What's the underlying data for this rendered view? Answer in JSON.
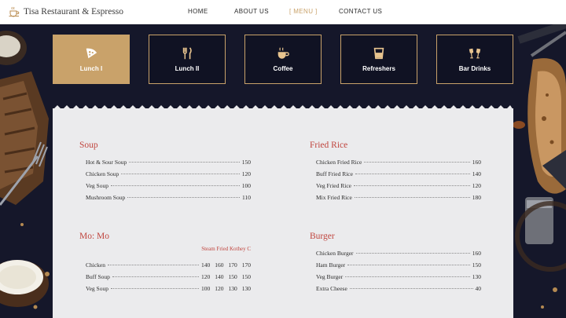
{
  "brand": {
    "name": "Tisa Restaurant & Espresso",
    "logo_icon": "coffee-cup-icon"
  },
  "nav": {
    "items": [
      {
        "label": "HOME"
      },
      {
        "label": "ABOUT US"
      },
      {
        "label": "[ MENU ]"
      },
      {
        "label": "CONTACT US"
      }
    ],
    "active_index": 2
  },
  "categories": [
    {
      "label": "Lunch I",
      "icon": "pizza-slice-icon",
      "active": true
    },
    {
      "label": "Lunch II",
      "icon": "fork-knife-icon",
      "active": false
    },
    {
      "label": "Coffee",
      "icon": "coffee-cup-icon",
      "active": false
    },
    {
      "label": "Refreshers",
      "icon": "glass-icon",
      "active": false
    },
    {
      "label": "Bar Drinks",
      "icon": "cheers-glasses-icon",
      "active": false
    }
  ],
  "colors": {
    "accent_gold": "#c9a26a",
    "section_title_red": "#c0453e",
    "background_navy": "#15172a",
    "panel_grey": "#ebebed"
  },
  "menu": {
    "soup": {
      "title": "Soup",
      "items": [
        {
          "name": "Hot & Sour Soup",
          "price": "150"
        },
        {
          "name": "Chicken Soup",
          "price": "120"
        },
        {
          "name": "Veg Soup",
          "price": "100"
        },
        {
          "name": "Mushroom Soup",
          "price": "110"
        }
      ]
    },
    "fried_rice": {
      "title": "Fried Rice",
      "items": [
        {
          "name": "Chicken Fried Rice",
          "price": "160"
        },
        {
          "name": "Buff Fried Rice",
          "price": "140"
        },
        {
          "name": "Veg Fried Rice",
          "price": "120"
        },
        {
          "name": "Mix Fried Rice",
          "price": "180"
        }
      ]
    },
    "momo": {
      "title": "Mo: Mo",
      "subheader": "Steam Fried Kothey C",
      "items": [
        {
          "name": "Chicken",
          "prices": [
            "140",
            "160",
            "170",
            "170"
          ]
        },
        {
          "name": "Buff Soup",
          "prices": [
            "120",
            "140",
            "150",
            "150"
          ]
        },
        {
          "name": "Veg Soup",
          "prices": [
            "100",
            "120",
            "130",
            "130"
          ]
        }
      ]
    },
    "burger": {
      "title": "Burger",
      "items": [
        {
          "name": "Chicken Burger",
          "price": "160"
        },
        {
          "name": "Ham Burger",
          "price": "150"
        },
        {
          "name": "Veg Burger",
          "price": "130"
        },
        {
          "name": "Extra Cheese",
          "price": "40"
        }
      ]
    }
  }
}
